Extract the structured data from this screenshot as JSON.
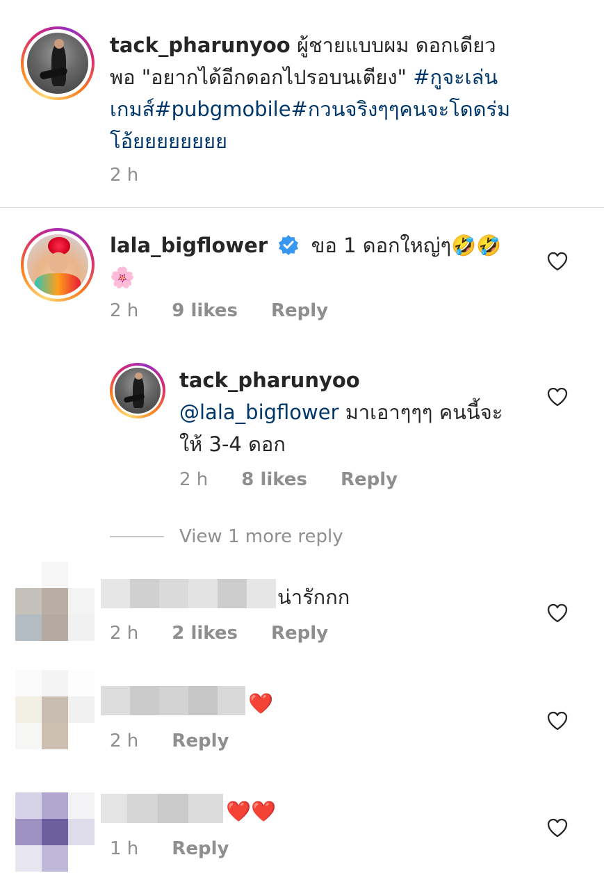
{
  "caption": {
    "username": "tack_pharunyoo",
    "text_part1": "ผู้ชายแบบผม ดอกเดียว",
    "text_part2": "พอ \"อยากได้อีกดอกไปรอบนเตียง\" ",
    "hashtag1": "#กูจะเล่น",
    "hashtag2": "เกมส์#pubgmobile#กวนจริงๆๆคนจะโดดร่ม",
    "hashtag3": "โอ้ยยยยยยยย",
    "time": "2 h"
  },
  "comments": [
    {
      "username": "lala_bigflower",
      "verified": true,
      "text": "ขอ 1 ดอกใหญ่ๆ",
      "emoji": "🤣🤣",
      "emoji2": "🌸",
      "time": "2 h",
      "likes": "9 likes",
      "reply_label": "Reply"
    },
    {
      "username": "tack_pharunyoo",
      "mention": "@lala_bigflower",
      "text_part1": " มาเอาๆๆๆ คนนี้จะ",
      "text_part2": "ให้ 3-4 ดอก",
      "time": "2 h",
      "likes": "8 likes",
      "reply_label": "Reply"
    },
    {
      "text": "น่ารักกก",
      "time": "2 h",
      "likes": "2 likes",
      "reply_label": "Reply"
    },
    {
      "emoji": "❤️",
      "time": "2 h",
      "reply_label": "Reply"
    },
    {
      "emoji": "❤️❤️",
      "time": "1 h",
      "reply_label": "Reply"
    }
  ],
  "view_more_replies": "View 1 more reply",
  "colors": {
    "link": "#00376b",
    "muted": "#8e8e8e",
    "verified": "#3897f0"
  }
}
